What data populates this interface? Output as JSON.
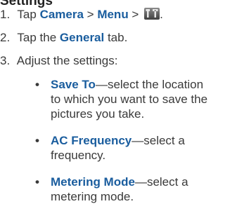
{
  "heading": "Settings",
  "steps": [
    {
      "num": "1.",
      "tap": "Tap ",
      "camera": "Camera",
      "gt1": " > ",
      "menu": "Menu",
      "gt2": " > ",
      "end": ".",
      "icon": "tools-icon"
    },
    {
      "num": "2.",
      "pre": "Tap the ",
      "general": "General",
      "post": " tab."
    },
    {
      "num": "3.",
      "text": "Adjust the settings:"
    }
  ],
  "bullets": [
    {
      "label": "Save To",
      "desc_line1": "—select the location",
      "desc_line2": "to which you want to save the",
      "desc_line3": "pictures you take."
    },
    {
      "label": "AC Frequency",
      "desc_line1": "—select a",
      "desc_line2": "frequency."
    },
    {
      "label": "Metering Mode",
      "desc_line1": "—select a",
      "desc_line2": "metering mode."
    }
  ],
  "colors": {
    "label": "#1a5d9e",
    "text": "#3a3a3a"
  }
}
